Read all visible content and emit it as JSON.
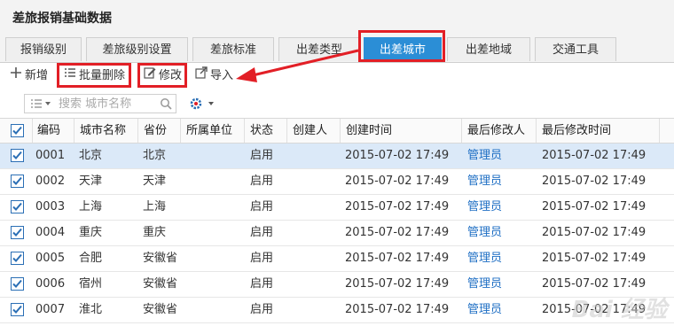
{
  "app": {
    "title": "差旅报销基础数据"
  },
  "tabs": [
    {
      "label": "报销级别",
      "active": false
    },
    {
      "label": "差旅级别设置",
      "active": false
    },
    {
      "label": "差旅标准",
      "active": false
    },
    {
      "label": "出差类型",
      "active": false
    },
    {
      "label": "出差城市",
      "active": true
    },
    {
      "label": "出差地域",
      "active": false
    },
    {
      "label": "交通工具",
      "active": false
    }
  ],
  "toolbar": {
    "add_label": "新增",
    "batch_delete_label": "批量删除",
    "edit_label": "修改",
    "import_label": "导入"
  },
  "search": {
    "placeholder": "搜索 城市名称",
    "value": ""
  },
  "columns": [
    "编码",
    "城市名称",
    "省份",
    "所属单位",
    "状态",
    "创建人",
    "创建时间",
    "最后修改人",
    "最后修改时间"
  ],
  "rows": [
    {
      "checked": true,
      "selected": true,
      "code": "0001",
      "city": "北京",
      "province": "北京",
      "unit": "",
      "status": "启用",
      "creator": "",
      "created": "2015-07-02 17:49",
      "modifier": "管理员",
      "modified": "2015-07-02 17:49"
    },
    {
      "checked": true,
      "selected": false,
      "code": "0002",
      "city": "天津",
      "province": "天津",
      "unit": "",
      "status": "启用",
      "creator": "",
      "created": "2015-07-02 17:49",
      "modifier": "管理员",
      "modified": "2015-07-02 17:49"
    },
    {
      "checked": true,
      "selected": false,
      "code": "0003",
      "city": "上海",
      "province": "上海",
      "unit": "",
      "status": "启用",
      "creator": "",
      "created": "2015-07-02 17:49",
      "modifier": "管理员",
      "modified": "2015-07-02 17:49"
    },
    {
      "checked": true,
      "selected": false,
      "code": "0004",
      "city": "重庆",
      "province": "重庆",
      "unit": "",
      "status": "启用",
      "creator": "",
      "created": "2015-07-02 17:49",
      "modifier": "管理员",
      "modified": "2015-07-02 17:49"
    },
    {
      "checked": true,
      "selected": false,
      "code": "0005",
      "city": "合肥",
      "province": "安徽省",
      "unit": "",
      "status": "启用",
      "creator": "",
      "created": "2015-07-02 17:49",
      "modifier": "管理员",
      "modified": "2015-07-02 17:49"
    },
    {
      "checked": true,
      "selected": false,
      "code": "0006",
      "city": "宿州",
      "province": "安徽省",
      "unit": "",
      "status": "启用",
      "creator": "",
      "created": "2015-07-02 17:49",
      "modifier": "管理员",
      "modified": "2015-07-02 17:49"
    },
    {
      "checked": true,
      "selected": false,
      "code": "0007",
      "city": "淮北",
      "province": "安徽省",
      "unit": "",
      "status": "启用",
      "creator": "",
      "created": "2015-07-02 17:49",
      "modifier": "管理员",
      "modified": "2015-07-02 17:49"
    }
  ],
  "watermark": "Bai 百度 经验",
  "colors": {
    "accent": "#2b8ed6",
    "annotation": "#e21f26",
    "link": "#1f6fc4",
    "selected_row": "#dbe9f8"
  }
}
